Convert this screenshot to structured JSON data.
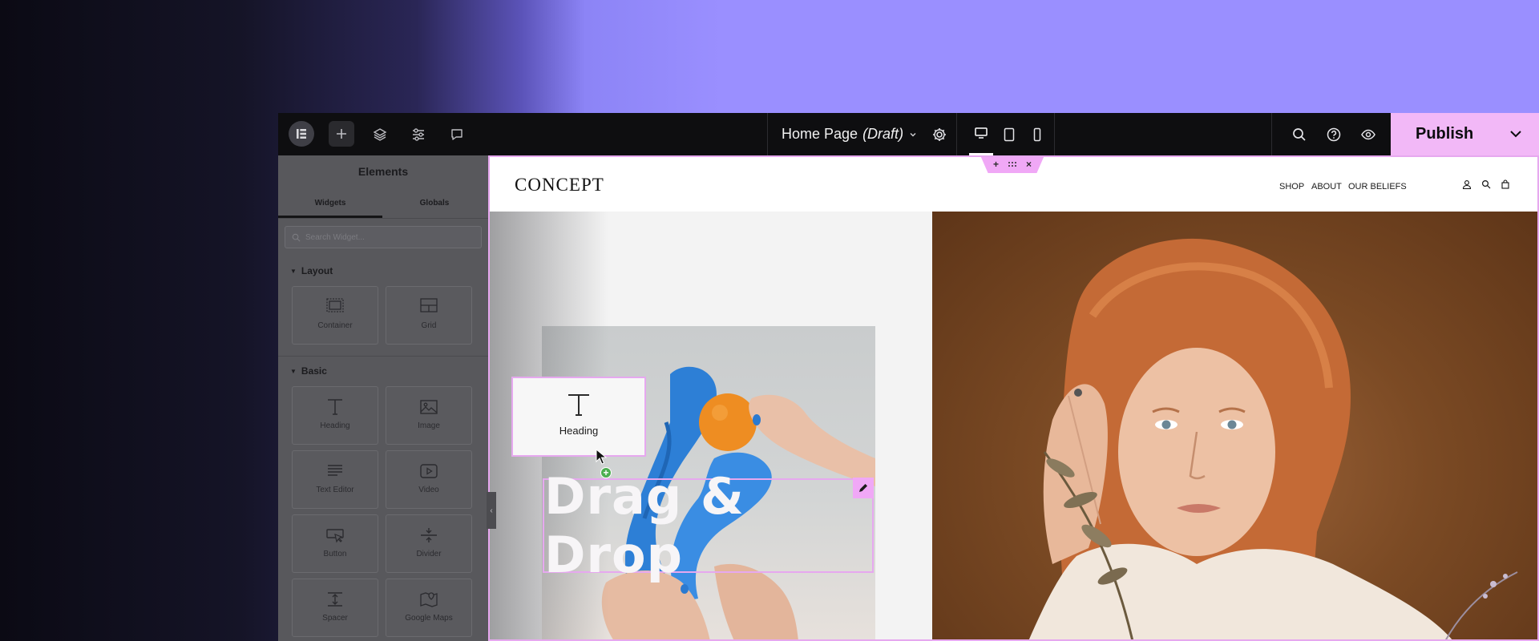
{
  "topbar": {
    "page_name": "Home Page",
    "page_status": "(Draft)",
    "publish_label": "Publish"
  },
  "panel": {
    "title": "Elements",
    "tabs": [
      {
        "label": "Widgets"
      },
      {
        "label": "Globals"
      }
    ],
    "search_placeholder": "Search Widget...",
    "sections": [
      {
        "label": "Layout",
        "items": [
          {
            "label": "Container"
          },
          {
            "label": "Grid"
          }
        ]
      },
      {
        "label": "Basic",
        "items": [
          {
            "label": "Heading"
          },
          {
            "label": "Image"
          },
          {
            "label": "Text Editor"
          },
          {
            "label": "Video"
          },
          {
            "label": "Button"
          },
          {
            "label": "Divider"
          },
          {
            "label": "Spacer"
          },
          {
            "label": "Google Maps"
          }
        ]
      }
    ]
  },
  "canvas": {
    "brand": "CONCEPT",
    "nav": [
      {
        "label": "SHOP"
      },
      {
        "label": "ABOUT"
      },
      {
        "label": "OUR BELIEFS"
      }
    ],
    "heading_text": "Drag & Drop",
    "dragged_widget_label": "Heading"
  },
  "colors": {
    "accent": "#f2b8f7",
    "topbar": "#0e0e10",
    "backdrop": "#9a8fff"
  }
}
